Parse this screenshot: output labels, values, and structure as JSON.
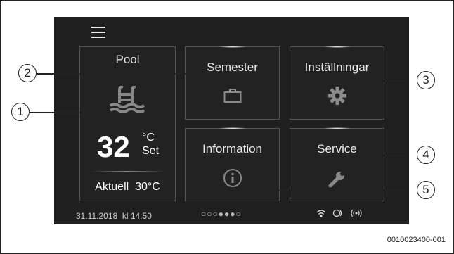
{
  "screen": {
    "menu_icon": "hamburger-menu-icon",
    "pool": {
      "title": "Pool",
      "icon": "pool-ladder-icon",
      "temperature": "32",
      "unit": "°C",
      "set_label": "Set",
      "actual_label": "Aktuell",
      "actual_value": "30°C"
    },
    "tiles": {
      "semester": {
        "label": "Semester",
        "icon": "suitcase-icon"
      },
      "installningar": {
        "label": "Inställningar",
        "icon": "gear-icon"
      },
      "information": {
        "label": "Information",
        "icon": "info-icon"
      },
      "service": {
        "label": "Service",
        "icon": "wrench-icon"
      }
    },
    "footer": {
      "date": "31.11.2018",
      "time": "kl 14:50",
      "page_dots": "○○○●●●○",
      "status_icons": [
        "wifi-icon",
        "internet-icon",
        "radio-signal-icon"
      ]
    },
    "nav": {
      "prev": "‹",
      "next": "›"
    }
  },
  "callouts": [
    "1",
    "2",
    "3",
    "4",
    "5"
  ],
  "document_number": "0010023400-001"
}
